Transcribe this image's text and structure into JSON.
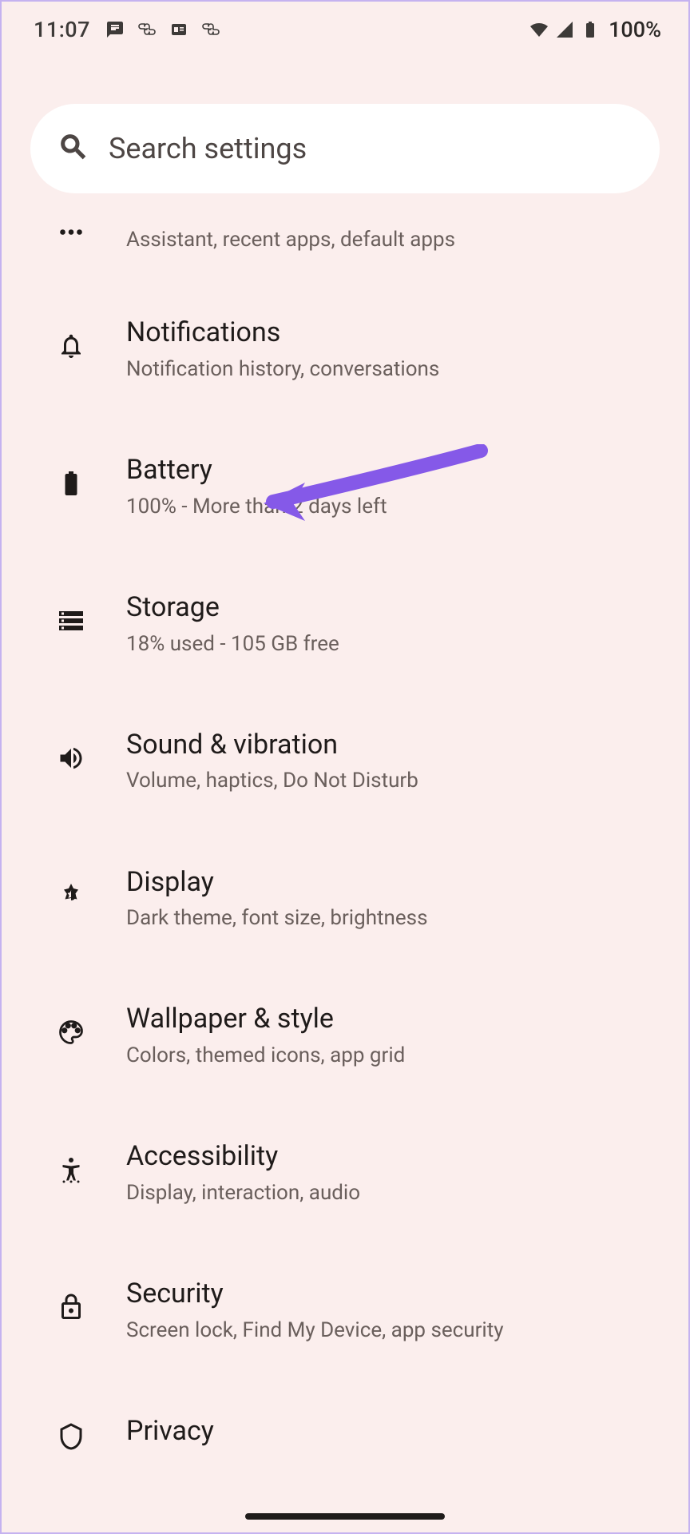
{
  "status_bar": {
    "time": "11:07",
    "battery_percent": "100%"
  },
  "search": {
    "placeholder": "Search settings"
  },
  "items": [
    {
      "title": "",
      "subtitle": "Assistant, recent apps, default apps",
      "icon": "dots"
    },
    {
      "title": "Notifications",
      "subtitle": "Notification history, conversations",
      "icon": "bell"
    },
    {
      "title": "Battery",
      "subtitle": "100% - More than 2 days left",
      "icon": "battery"
    },
    {
      "title": "Storage",
      "subtitle": "18% used - 105 GB free",
      "icon": "storage"
    },
    {
      "title": "Sound & vibration",
      "subtitle": "Volume, haptics, Do Not Disturb",
      "icon": "sound"
    },
    {
      "title": "Display",
      "subtitle": "Dark theme, font size, brightness",
      "icon": "display"
    },
    {
      "title": "Wallpaper & style",
      "subtitle": "Colors, themed icons, app grid",
      "icon": "palette"
    },
    {
      "title": "Accessibility",
      "subtitle": "Display, interaction, audio",
      "icon": "accessibility"
    },
    {
      "title": "Security",
      "subtitle": "Screen lock, Find My Device, app security",
      "icon": "lock"
    },
    {
      "title": "Privacy",
      "subtitle": "",
      "icon": "privacy"
    }
  ],
  "annotation": {
    "arrow_color": "#8559e8"
  }
}
